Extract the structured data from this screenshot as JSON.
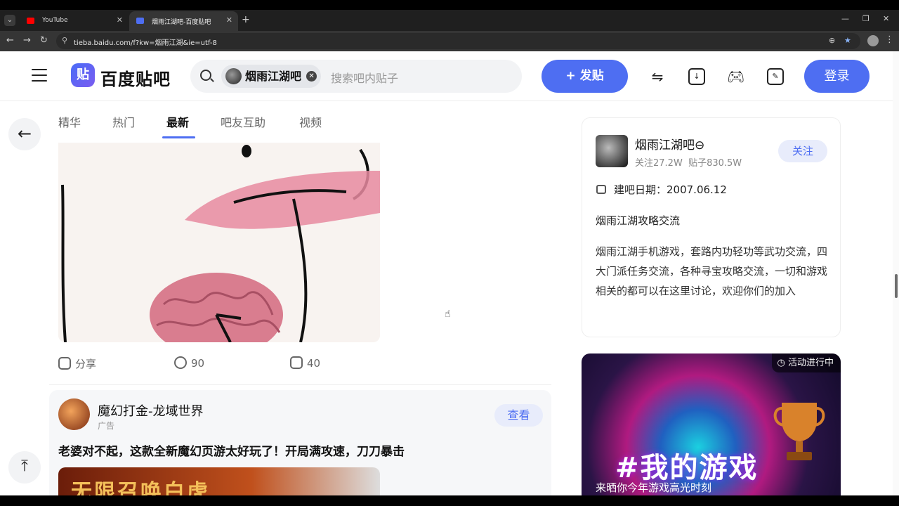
{
  "browser": {
    "tabs": [
      {
        "title": "YouTube",
        "active": false,
        "favicon_color": "#ff0000"
      },
      {
        "title": "烟雨江湖吧-百度贴吧",
        "active": true,
        "favicon_color": "#4e6ef2"
      }
    ],
    "url": "tieba.baidu.com/f?kw=烟雨江湖&ie=utf-8"
  },
  "header": {
    "logo_badge": "贴",
    "logo_text": "百度贴吧",
    "search": {
      "forum_chip": "烟雨江湖吧",
      "placeholder": "搜索吧内贴子"
    },
    "post_button": "+ 发贴",
    "login_button": "登录",
    "accent_color": "#4e6ef2"
  },
  "tabs": [
    {
      "label": "精华",
      "selected": false
    },
    {
      "label": "热门",
      "selected": false
    },
    {
      "label": "最新",
      "selected": true
    },
    {
      "label": "吧友互助",
      "selected": false
    },
    {
      "label": "视频",
      "selected": false
    }
  ],
  "post": {
    "share_label": "分享",
    "comment_count": "90",
    "like_count": "40"
  },
  "ad": {
    "title": "魔幻打金-龙域世界",
    "label": "广告",
    "view_button": "查看",
    "text": "老婆对不起，这款全新魔幻页游太好玩了！开局满攻速，刀刀暴击",
    "banner_text": "无限召唤白虎"
  },
  "forum_info": {
    "name": "烟雨江湖吧⊖",
    "followers": "关注27.2W",
    "posts": "贴子830.5W",
    "follow_button": "关注",
    "created": "建吧日期：2007.06.12",
    "slogan": "烟雨江湖攻略交流",
    "description": "烟雨江湖手机游戏，套路内功轻功等武功交流，四大门派任务交流，各种寻宝攻略交流，一切和游戏相关的都可以在这里讨论，欢迎你们的加入"
  },
  "promo": {
    "badge": "活动进行中",
    "title": "#我的游戏",
    "subtitle": "来晒你今年游戏高光时刻"
  }
}
